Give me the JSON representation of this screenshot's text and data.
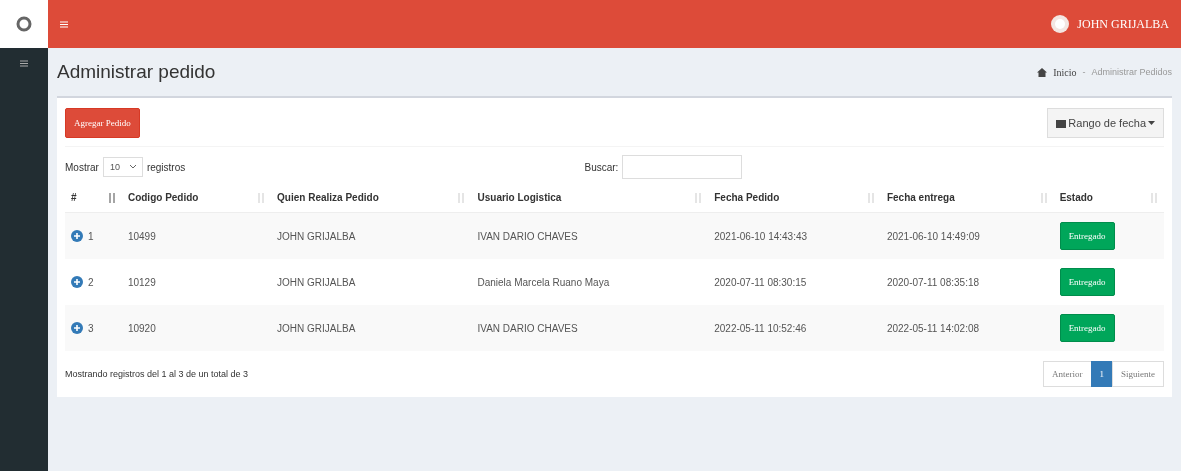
{
  "header": {
    "user": "JOHN GRIJALBA"
  },
  "page": {
    "title": "Administrar pedido",
    "breadcrumb": [
      "Inicio",
      "Administrar Pedidos"
    ],
    "breadcrumb_separator": "-"
  },
  "toolbar": {
    "add_button": "Agregar Pedido",
    "date_range_button": "Rango de fecha"
  },
  "length_control": {
    "prefix": "Mostrar",
    "value": "10",
    "suffix": "registros"
  },
  "search": {
    "label": "Buscar:"
  },
  "table": {
    "columns": [
      "#",
      "Codigo Pedido",
      "Quien Realiza Pedido",
      "Usuario Logistica",
      "Fecha Pedido",
      "Fecha entrega",
      "Estado"
    ],
    "rows": [
      {
        "index": "1",
        "code": "10499",
        "requester": "JOHN GRIJALBA",
        "logistics_user": "IVAN DARIO CHAVES",
        "order_date": "2021-06-10 14:43:43",
        "delivery_date": "2021-06-10 14:49:09",
        "status": "Entregado"
      },
      {
        "index": "2",
        "code": "10129",
        "requester": "JOHN GRIJALBA",
        "logistics_user": "Daniela Marcela Ruano Maya",
        "order_date": "2020-07-11 08:30:15",
        "delivery_date": "2020-07-11 08:35:18",
        "status": "Entregado"
      },
      {
        "index": "3",
        "code": "10920",
        "requester": "JOHN GRIJALBA",
        "logistics_user": "IVAN DARIO CHAVES",
        "order_date": "2022-05-11 10:52:46",
        "delivery_date": "2022-05-11 14:02:08",
        "status": "Entregado"
      }
    ]
  },
  "footer": {
    "info": "Mostrando registros del 1 al 3 de un total de 3"
  },
  "pagination": [
    {
      "label": "Anterior",
      "selected": false
    },
    {
      "label": "1",
      "selected": true
    },
    {
      "label": "Siguiente",
      "selected": false
    }
  ]
}
